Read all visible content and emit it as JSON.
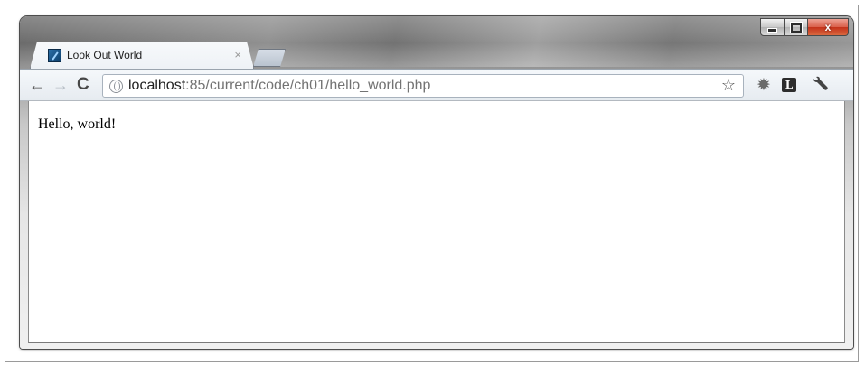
{
  "window": {
    "minimize_icon": "minimize-icon",
    "maximize_icon": "maximize-icon",
    "close_label": "x"
  },
  "tabs": [
    {
      "title": "Look Out World",
      "close_label": "×",
      "favicon": "site-favicon"
    }
  ],
  "toolbar": {
    "back_label": "←",
    "forward_label": "→",
    "reload_label": "C",
    "address": {
      "host": "localhost",
      "rest": ":85/current/code/ch01/hello_world.php"
    },
    "star_label": "☆",
    "gear_label": "✹",
    "ext_label": "L",
    "wrench_label": "🔧"
  },
  "page": {
    "text": "Hello, world!"
  }
}
